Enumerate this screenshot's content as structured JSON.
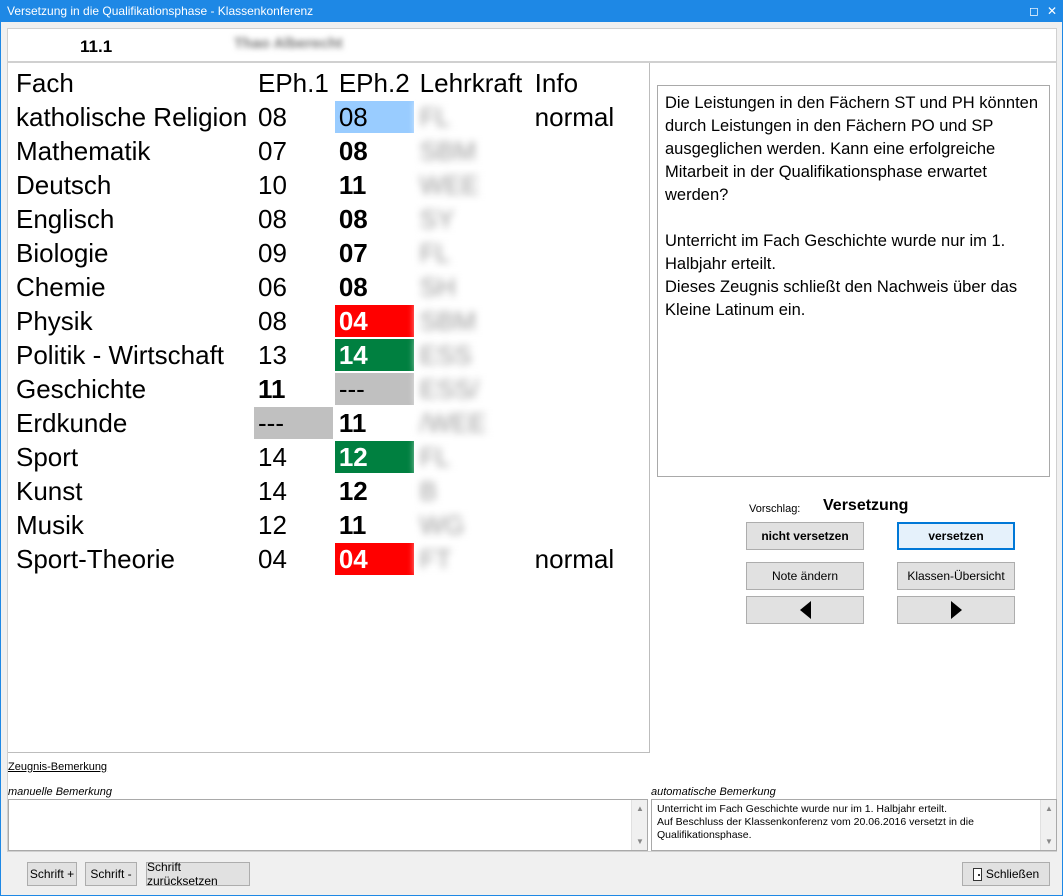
{
  "window": {
    "title": "Versetzung in die Qualifikationsphase - Klassenkonferenz"
  },
  "tab": {
    "class_label": "11.1",
    "student_name": "Thao Alberecht"
  },
  "grades": {
    "headers": [
      "Fach",
      "EPh.1",
      "EPh.2",
      "Lehrkraft",
      "Info"
    ],
    "rows": [
      {
        "subject": "katholische Religion",
        "e1": "08",
        "e2": "08",
        "teacher": "FL",
        "info": "normal",
        "e1_bold": false,
        "e2_bold": false,
        "e1_bg": "#ffffff",
        "e2_bg": "#99ccff",
        "e2_color": "#000000"
      },
      {
        "subject": "Mathematik",
        "e1": "07",
        "e2": "08",
        "teacher": "SBM",
        "info": "",
        "e1_bold": false,
        "e2_bold": true,
        "e1_bg": "#ffffff",
        "e2_bg": "#ffffff",
        "e2_color": "#000000"
      },
      {
        "subject": "Deutsch",
        "e1": "10",
        "e2": "11",
        "teacher": "WEE",
        "info": "",
        "e1_bold": false,
        "e2_bold": true,
        "e1_bg": "#ffffff",
        "e2_bg": "#ffffff",
        "e2_color": "#000000"
      },
      {
        "subject": "Englisch",
        "e1": "08",
        "e2": "08",
        "teacher": "SY",
        "info": "",
        "e1_bold": false,
        "e2_bold": true,
        "e1_bg": "#ffffff",
        "e2_bg": "#ffffff",
        "e2_color": "#000000"
      },
      {
        "subject": "Biologie",
        "e1": "09",
        "e2": "07",
        "teacher": "FL",
        "info": "",
        "e1_bold": false,
        "e2_bold": true,
        "e1_bg": "#ffffff",
        "e2_bg": "#ffffff",
        "e2_color": "#000000"
      },
      {
        "subject": "Chemie",
        "e1": "06",
        "e2": "08",
        "teacher": "SH",
        "info": "",
        "e1_bold": false,
        "e2_bold": true,
        "e1_bg": "#ffffff",
        "e2_bg": "#ffffff",
        "e2_color": "#000000"
      },
      {
        "subject": "Physik",
        "e1": "08",
        "e2": "04",
        "teacher": "SBM",
        "info": "",
        "e1_bold": false,
        "e2_bold": true,
        "e1_bg": "#ffffff",
        "e2_bg": "#ff0000",
        "e2_color": "#ffffff"
      },
      {
        "subject": "Politik - Wirtschaft",
        "e1": "13",
        "e2": "14",
        "teacher": "ESS",
        "info": "",
        "e1_bold": false,
        "e2_bold": true,
        "e1_bg": "#ffffff",
        "e2_bg": "#008040",
        "e2_color": "#ffffff"
      },
      {
        "subject": "Geschichte",
        "e1": "11",
        "e2": "---",
        "teacher": "ESS/",
        "info": "",
        "e1_bold": true,
        "e2_bold": false,
        "e1_bg": "#ffffff",
        "e2_bg": "#c0c0c0",
        "e2_color": "#000000"
      },
      {
        "subject": "Erdkunde",
        "e1": "---",
        "e2": "11",
        "teacher": "/WEE",
        "info": "",
        "e1_bold": false,
        "e2_bold": true,
        "e1_bg": "#c0c0c0",
        "e2_bg": "#ffffff",
        "e2_color": "#000000"
      },
      {
        "subject": "Sport",
        "e1": "14",
        "e2": "12",
        "teacher": "FL",
        "info": "",
        "e1_bold": false,
        "e2_bold": true,
        "e1_bg": "#ffffff",
        "e2_bg": "#008040",
        "e2_color": "#ffffff"
      },
      {
        "subject": "Kunst",
        "e1": "14",
        "e2": "12",
        "teacher": "B",
        "info": "",
        "e1_bold": false,
        "e2_bold": true,
        "e1_bg": "#ffffff",
        "e2_bg": "#ffffff",
        "e2_color": "#000000"
      },
      {
        "subject": "Musik",
        "e1": "12",
        "e2": "11",
        "teacher": "WG",
        "info": "",
        "e1_bold": false,
        "e2_bold": true,
        "e1_bg": "#ffffff",
        "e2_bg": "#ffffff",
        "e2_color": "#000000"
      },
      {
        "subject": "Sport-Theorie",
        "e1": "04",
        "e2": "04",
        "teacher": "FT",
        "info": "normal",
        "e1_bold": false,
        "e2_bold": true,
        "e1_bg": "#ffffff",
        "e2_bg": "#ff0000",
        "e2_color": "#ffffff"
      }
    ]
  },
  "info_box": {
    "para1": "Die Leistungen in den Fächern ST und PH könnten durch Leistungen in den Fächern PO und SP ausgeglichen werden. Kann eine erfolgreiche Mitarbeit in der Qualifikationsphase erwartet werden?",
    "para2_line1": "Unterricht im Fach Geschichte wurde nur im 1. Halbjahr erteilt.",
    "para2_line2": "Dieses Zeugnis schließt den Nachweis über das Kleine Latinum ein."
  },
  "proposal": {
    "label": "Vorschlag:",
    "value": "Versetzung"
  },
  "buttons": {
    "nicht_versetzen": "nicht versetzen",
    "versetzen": "versetzen",
    "note_aendern": "Note ändern",
    "klassen_uebersicht": "Klassen-Übersicht"
  },
  "remarks": {
    "zeugnis_link": "Zeugnis-Bemerkung",
    "manual_label": "manuelle Bemerkung",
    "manual_value": "",
    "auto_label": "automatische Bemerkung",
    "auto_line1": "Unterricht im Fach Geschichte wurde nur im 1. Halbjahr erteilt.",
    "auto_line2": "Auf Beschluss der Klassenkonferenz vom 20.06.2016 versetzt in die Qualifikationsphase."
  },
  "footer": {
    "font_plus": "Schrift +",
    "font_minus": "Schrift -",
    "font_reset": "Schrift zurücksetzen",
    "close": "Schließen"
  },
  "colors": {
    "titlebar": "#1e88e5",
    "grade_red": "#ff0000",
    "grade_green": "#008040",
    "grade_blue": "#99ccff",
    "grade_gray": "#c0c0c0"
  }
}
